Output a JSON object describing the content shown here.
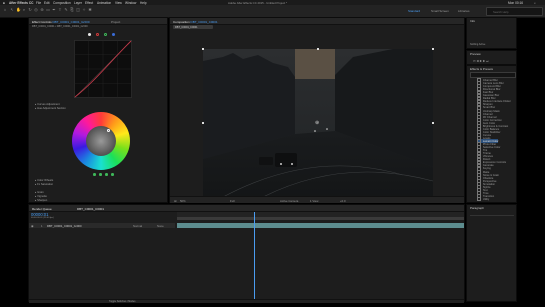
{
  "menubar": {
    "items": [
      "After Effects CC",
      "File",
      "Edit",
      "Composition",
      "Layer",
      "Effect",
      "Animation",
      "View",
      "Window",
      "Help"
    ],
    "app_title": "Adobe After Effects CC 2015 - Untitled Project *",
    "clock": "Mon 00:16"
  },
  "toolbar": {
    "workspaces": [
      "Standard",
      "Small Screen",
      "Libraries"
    ],
    "active_workspace": "Standard",
    "search_placeholder": "Search Help"
  },
  "effect_controls": {
    "tab_label": "Effect Controls",
    "project_tab": "Project",
    "layer_name": "DBT_C0001_C0001_Gr000",
    "comp_path": "DBT_C0001_C0001 • DBT_C0001_C0001_Gr000",
    "rgb_dots": [
      "#e8e8e8",
      "#d23a3a",
      "#3fb85a",
      "#3a6cd8"
    ],
    "section_rows": [
      "Curves Adjustment",
      "Hue Adjustment Section"
    ],
    "bottom_rows": [
      "Color Wheels",
      "Fx Saturation",
      "Grain",
      "Vignette",
      "Sharpen"
    ]
  },
  "composition": {
    "tab_label": "Composition",
    "comp_name": "DBT_C0001_C0001",
    "sub_tab": "DBT_C0001_C0001",
    "footer_items": [
      "50%",
      "Full",
      "Active Camera",
      "1 View",
      "+0.0"
    ]
  },
  "right_panels": {
    "info_tab": "Info",
    "preview_tab": "Preview",
    "effects_tab": "Effects & Presets",
    "info_readout": "Nothing Active",
    "effects_list": [
      "Channel Blur",
      "Camera Lens Blur",
      "Compound Blur",
      "Directional Blur",
      "Fast Blur",
      "Gaussian Blur",
      "Radial Blur",
      "Reduce Interlace Flicker",
      "Sharpen",
      "Smart Blur",
      "Unsharp Mask",
      "Channel",
      "3D Channel",
      "Color Correction",
      "Auto Color",
      "Brightness & Contrast",
      "Color Balance",
      "Color Stabilizer",
      "Curves",
      "Levels",
      "Lumetri Color",
      "Photo Filter",
      "Selective Color",
      "Tint",
      "Tritone",
      "Vibrance",
      "Distort",
      "Expression Controls",
      "Generate",
      "Keying",
      "Matte",
      "Noise & Grain",
      "Obsolete",
      "Perspective",
      "Simulation",
      "Stylize",
      "Text",
      "Time",
      "Transition",
      "Utility"
    ],
    "selected_effect": "Lumetri Color"
  },
  "timeline": {
    "tab_label": "DBT_C0001_C0001",
    "render_queue_tab": "Render Queue",
    "timecode": "00000:01",
    "fps": "00:00:00:01 (25.00 fps)",
    "layer_name": "DBT_C0001_C0001_Gr000",
    "layer_number": "1",
    "mode": "Normal",
    "parent": "None",
    "footer_label": "Toggle Switches / Modes",
    "paragraph_tab": "Paragraph"
  }
}
